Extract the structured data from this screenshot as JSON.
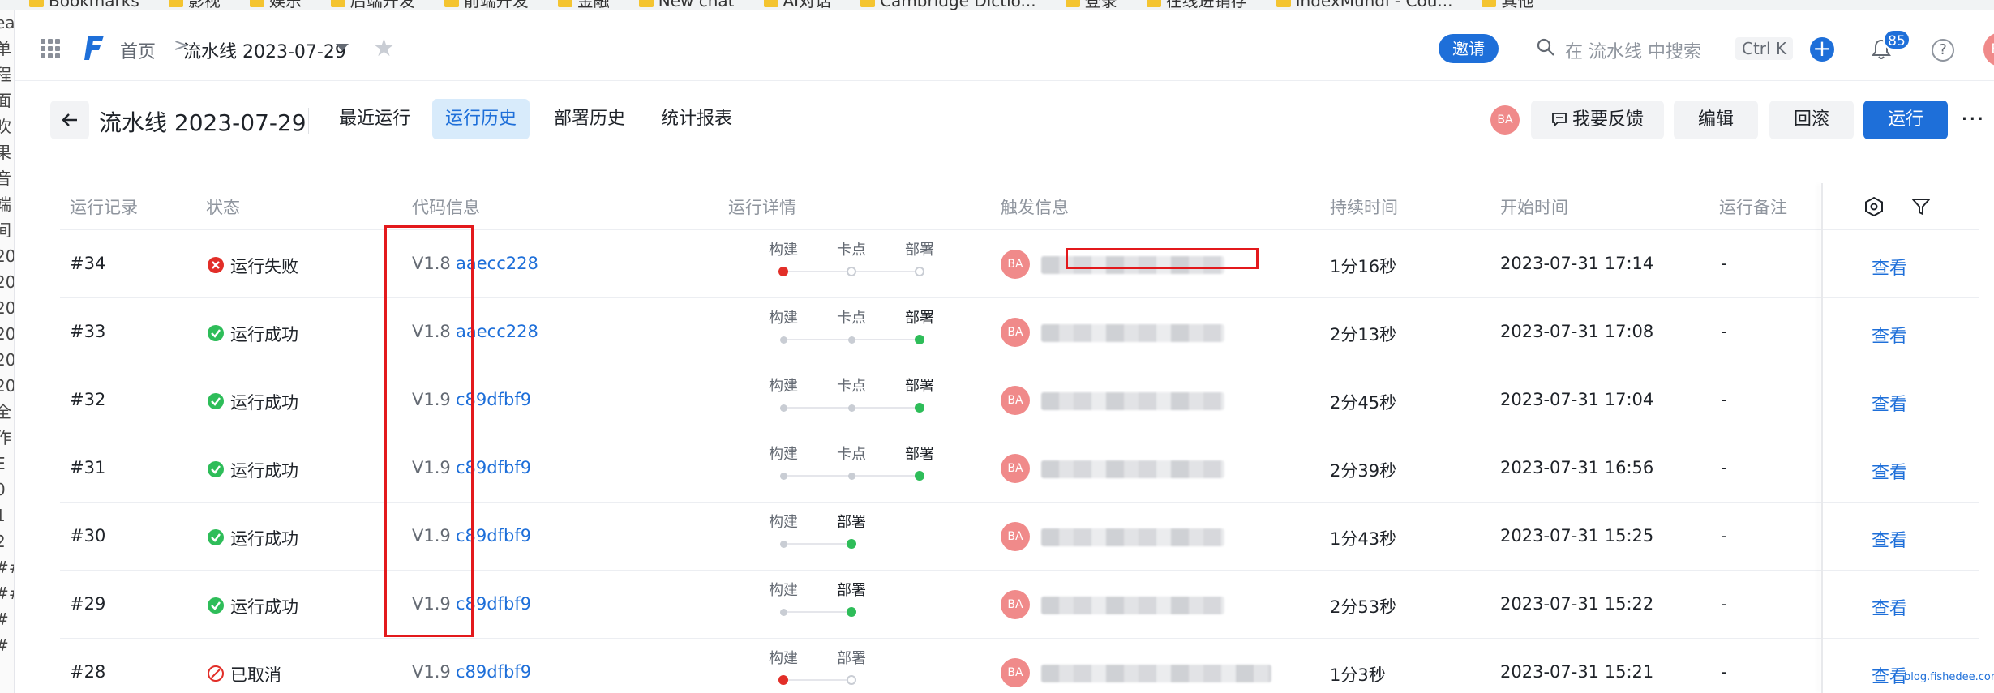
{
  "bookmarks": [
    "Bookmarks",
    "影视",
    "娱乐",
    "后端开发",
    "前端开发",
    "金融",
    "New chat",
    "AI对话",
    "Cambridge Dictio...",
    "登录",
    "在线进销存",
    "IndexMundi - Cou...",
    "其他"
  ],
  "left_strip": [
    "ea",
    "单",
    "程",
    "面",
    "吹",
    "果",
    "音",
    "端",
    "间",
    "20",
    "20",
    "20",
    "20",
    "20",
    "20",
    "全",
    "作",
    "E",
    "0",
    "1",
    "2",
    "##",
    "##",
    "#",
    "#"
  ],
  "nav": {
    "home": "首页",
    "separator": ">",
    "current": "流水线 2023-07-29",
    "invite": "邀请",
    "search_placeholder": "在 流水线 中搜索",
    "shortcut": "Ctrl K",
    "plus": "+",
    "notification_count": "85",
    "help": "?",
    "avatar": "BA"
  },
  "header": {
    "title": "流水线 2023-07-29",
    "tabs": [
      "最近运行",
      "运行历史",
      "部署历史",
      "统计报表"
    ],
    "active_tab": 1,
    "avatar": "BA",
    "feedback": "我要反馈",
    "edit": "编辑",
    "rollback": "回滚",
    "run": "运行",
    "more": "···"
  },
  "table": {
    "columns": [
      "运行记录",
      "状态",
      "代码信息",
      "运行详情",
      "触发信息",
      "持续时间",
      "开始时间",
      "运行备注"
    ],
    "rows": [
      {
        "id": "#34",
        "status": "运行失败",
        "status_kind": "fail",
        "version": "V1.8",
        "commit": "aaecc228",
        "stages": [
          {
            "name": "构建",
            "state": "red"
          },
          {
            "name": "卡点",
            "state": "hollow"
          },
          {
            "name": "部署",
            "state": "hollow"
          }
        ],
        "avatar": "BA",
        "duration": "1分16秒",
        "start": "2023-07-31 17:14",
        "note": "-",
        "action": "查看"
      },
      {
        "id": "#33",
        "status": "运行成功",
        "status_kind": "ok",
        "version": "V1.8",
        "commit": "aaecc228",
        "stages": [
          {
            "name": "构建",
            "state": "gray"
          },
          {
            "name": "卡点",
            "state": "gray"
          },
          {
            "name": "部署",
            "state": "green"
          }
        ],
        "avatar": "BA",
        "duration": "2分13秒",
        "start": "2023-07-31 17:08",
        "note": "-",
        "action": "查看"
      },
      {
        "id": "#32",
        "status": "运行成功",
        "status_kind": "ok",
        "version": "V1.9",
        "commit": "c89dfbf9",
        "stages": [
          {
            "name": "构建",
            "state": "gray"
          },
          {
            "name": "卡点",
            "state": "gray"
          },
          {
            "name": "部署",
            "state": "green"
          }
        ],
        "avatar": "BA",
        "duration": "2分45秒",
        "start": "2023-07-31 17:04",
        "note": "-",
        "action": "查看"
      },
      {
        "id": "#31",
        "status": "运行成功",
        "status_kind": "ok",
        "version": "V1.9",
        "commit": "c89dfbf9",
        "stages": [
          {
            "name": "构建",
            "state": "gray"
          },
          {
            "name": "卡点",
            "state": "gray"
          },
          {
            "name": "部署",
            "state": "green"
          }
        ],
        "avatar": "BA",
        "duration": "2分39秒",
        "start": "2023-07-31 16:56",
        "note": "-",
        "action": "查看"
      },
      {
        "id": "#30",
        "status": "运行成功",
        "status_kind": "ok",
        "version": "V1.9",
        "commit": "c89dfbf9",
        "stages": [
          {
            "name": "构建",
            "state": "gray"
          },
          {
            "name": "部署",
            "state": "green"
          }
        ],
        "avatar": "BA",
        "duration": "1分43秒",
        "start": "2023-07-31 15:25",
        "note": "-",
        "action": "查看"
      },
      {
        "id": "#29",
        "status": "运行成功",
        "status_kind": "ok",
        "version": "V1.9",
        "commit": "c89dfbf9",
        "stages": [
          {
            "name": "构建",
            "state": "gray"
          },
          {
            "name": "部署",
            "state": "green"
          }
        ],
        "avatar": "BA",
        "duration": "2分53秒",
        "start": "2023-07-31 15:22",
        "note": "-",
        "action": "查看"
      },
      {
        "id": "#28",
        "status": "已取消",
        "status_kind": "cancel",
        "version": "V1.9",
        "commit": "c89dfbf9",
        "stages": [
          {
            "name": "构建",
            "state": "red"
          },
          {
            "name": "部署",
            "state": "hollow"
          }
        ],
        "avatar": "BA",
        "duration": "1分3秒",
        "start": "2023-07-31 15:21",
        "note": "-",
        "action": "查看"
      }
    ]
  },
  "watermark": "blog.fishedee.com",
  "colors": {
    "primary": "#1e6fd9",
    "success": "#2ebd59",
    "danger": "#e22e28",
    "annotation": "#e3191c"
  }
}
